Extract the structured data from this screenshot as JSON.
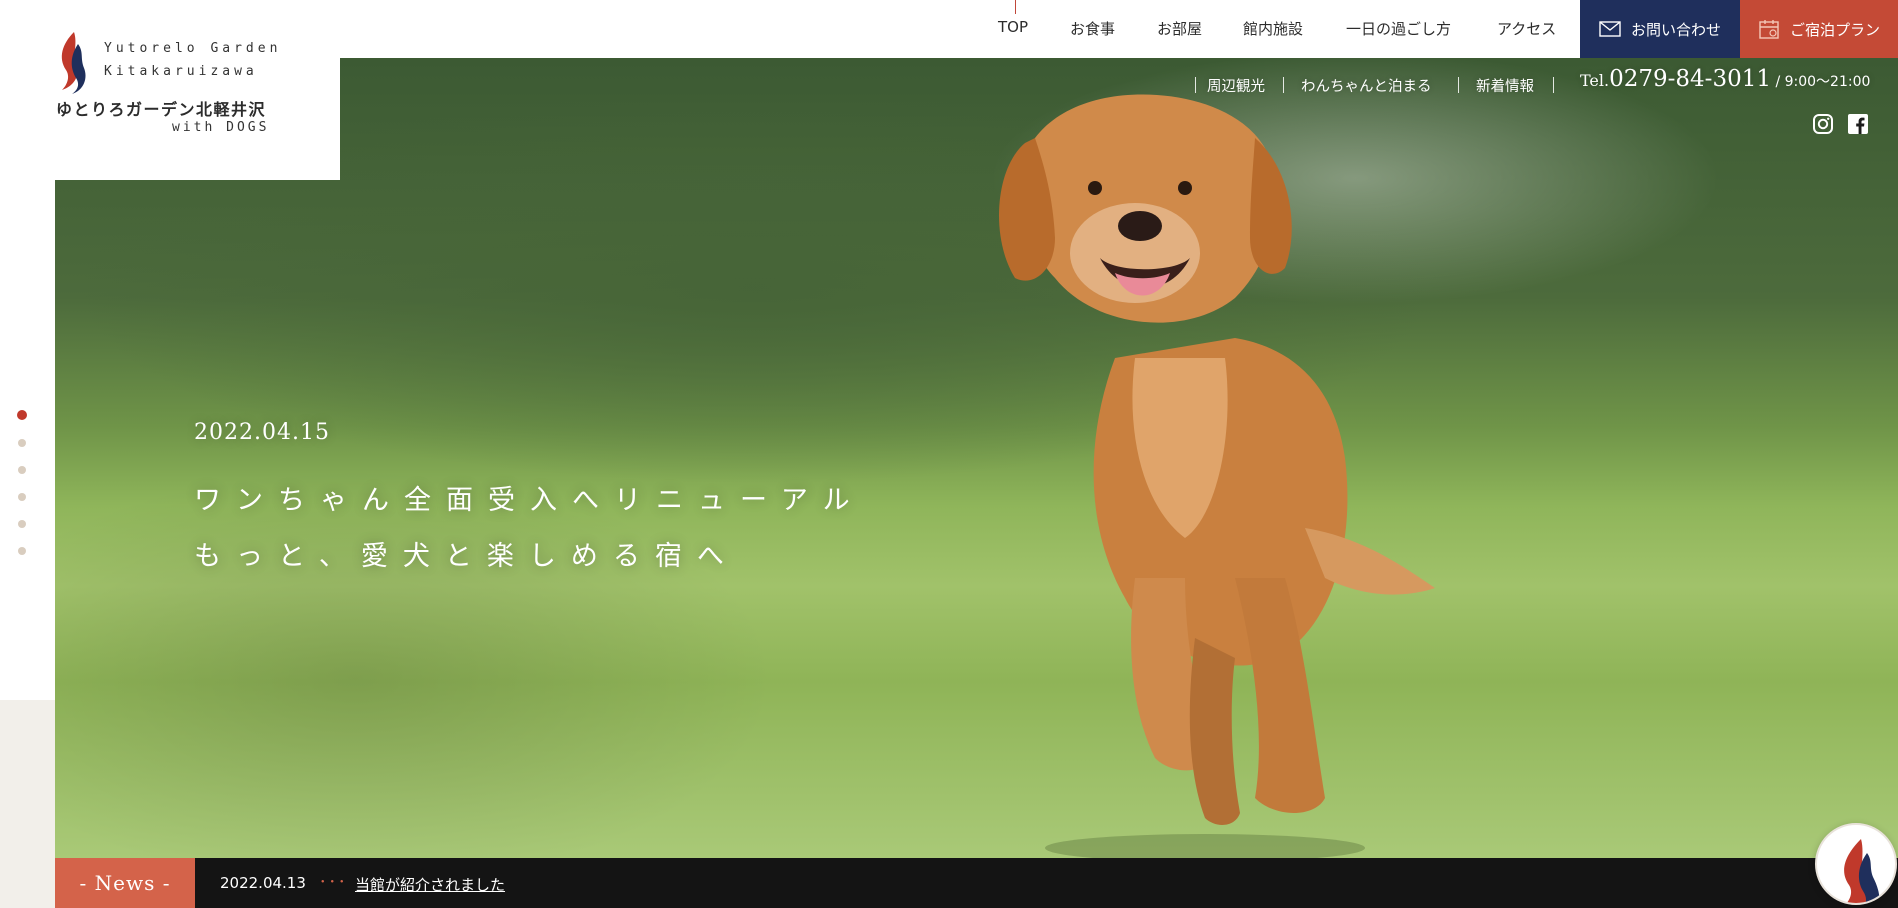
{
  "logo": {
    "en_line1": "Yutorelo Garden",
    "en_line2": "Kitakaruizawa",
    "ja_name": "ゆとりろガーデン北軽井沢",
    "with_dogs": "with DOGS"
  },
  "nav": {
    "items": [
      "TOP",
      "お食事",
      "お部屋",
      "館内施設",
      "一日の過ごし方",
      "アクセス"
    ],
    "contact_label": "お問い合わせ",
    "plan_label": "ご宿泊プラン"
  },
  "subnav": {
    "items": [
      "周辺観光",
      "わんちゃんと泊まる",
      "新着情報"
    ],
    "tel_prefix": "Tel.",
    "tel_number": "0279-84-3011",
    "tel_hours": " / 9:00〜21:00"
  },
  "social": [
    "instagram-icon",
    "facebook-icon"
  ],
  "hero": {
    "date": "2022.04.15",
    "line1": "ワンちゃん全面受入へリニューアル",
    "line2": "もっと、愛犬と楽しめる宿へ"
  },
  "slider": {
    "count": 6,
    "active": 0
  },
  "news": {
    "label": "- News -",
    "date": "2022.04.13",
    "dots": "･･･",
    "title": "当館が紹介されました"
  },
  "colors": {
    "navy": "#1f2f5c",
    "brand_red": "#c44a36",
    "news_orange": "#d4634a"
  }
}
